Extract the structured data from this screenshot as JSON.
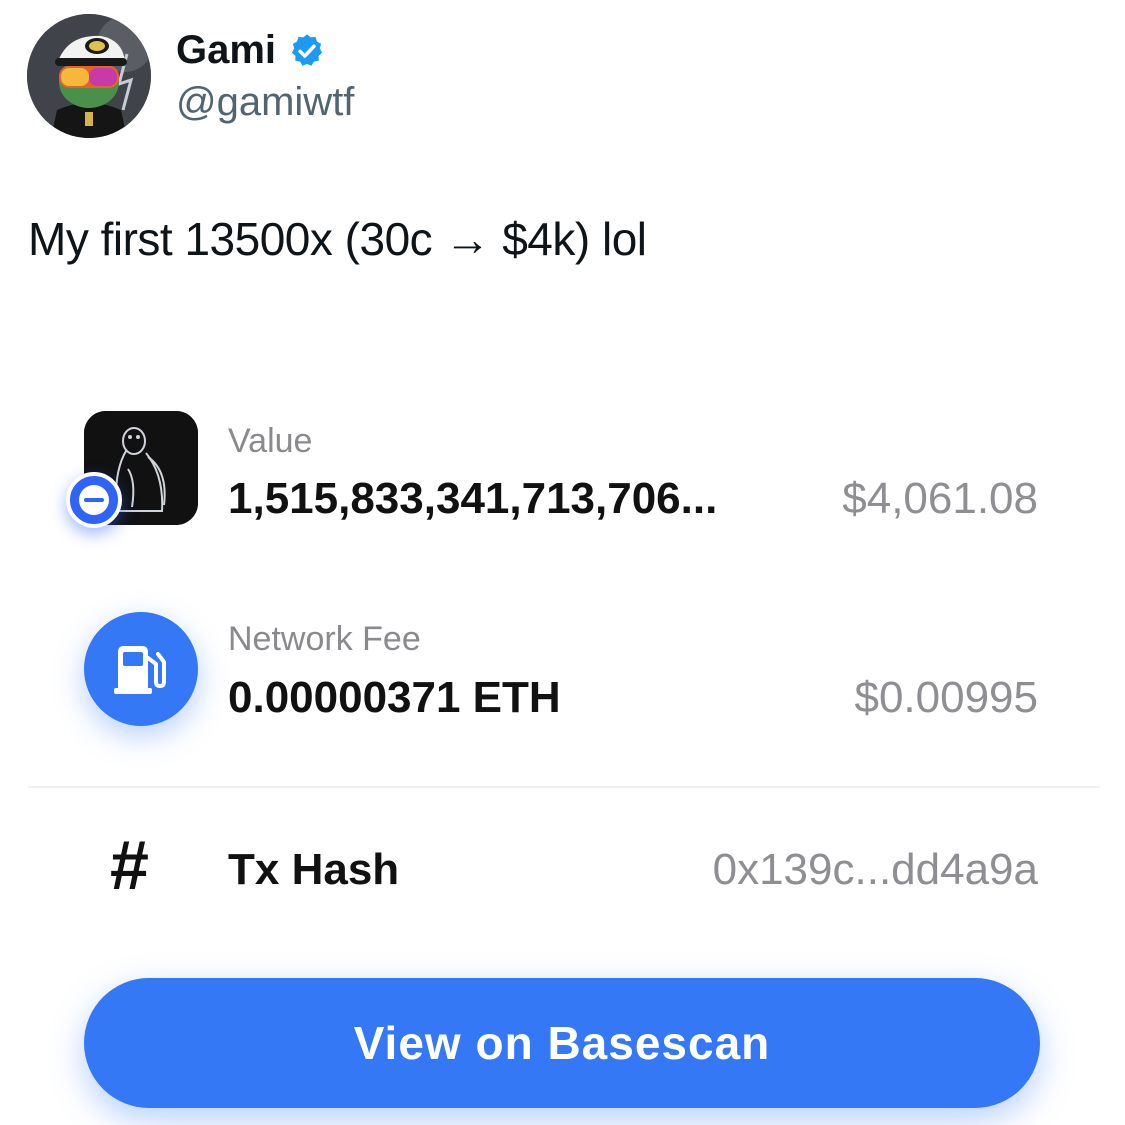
{
  "author": {
    "name": "Gami",
    "handle": "@gamiwtf",
    "verified": true,
    "avatar": "user-avatar"
  },
  "tweet": {
    "text": "My first 13500x (30c → $4k) lol"
  },
  "transaction": {
    "value": {
      "label": "Value",
      "amount": "1,515,833,341,713,706...",
      "usd": "$4,061.08",
      "icon": "penguin-token-icon",
      "badge_icon": "minus-icon"
    },
    "network_fee": {
      "label": "Network Fee",
      "amount": "0.00000371 ETH",
      "usd": "$0.00995",
      "icon": "gas-pump-icon"
    },
    "tx_hash": {
      "icon": "#",
      "label": "Tx Hash",
      "value": "0x139c...dd4a9a"
    }
  },
  "actions": {
    "view_button_label": "View on Basescan"
  },
  "colors": {
    "accent": "#3478f6",
    "verified": "#1d9bf0",
    "text_primary": "#111111",
    "text_secondary": "#8e8e93"
  }
}
